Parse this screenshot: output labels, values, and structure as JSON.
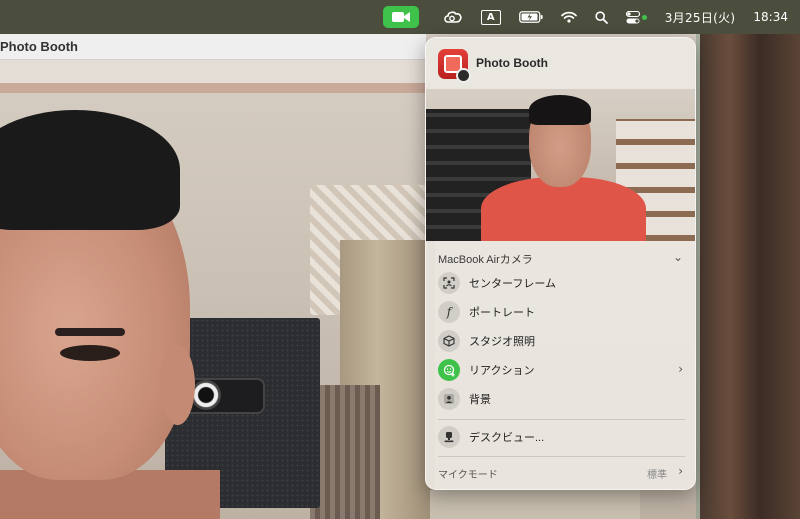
{
  "menubar": {
    "date": "3月25日(火)",
    "time": "18:34",
    "input_indicator": "A",
    "icons": [
      "facetime-camera-icon",
      "creative-cloud-icon",
      "input-source-icon",
      "battery-icon",
      "wifi-icon",
      "search-icon",
      "control-center-icon"
    ],
    "accent_color": "#3ec24a"
  },
  "photobooth": {
    "window_title": "Photo Booth"
  },
  "popover": {
    "app_name": "Photo Booth",
    "camera_section": "MacBook Airカメラ",
    "items": [
      {
        "label": "センターフレーム",
        "icon": "center-stage-icon"
      },
      {
        "label": "ポートレート",
        "icon": "portrait-icon"
      },
      {
        "label": "スタジオ照明",
        "icon": "studio-light-icon"
      },
      {
        "label": "リアクション",
        "icon": "reactions-icon"
      },
      {
        "label": "背景",
        "icon": "background-icon"
      }
    ],
    "desk_view": "デスクビュー...",
    "mic_mode_label": "マイクモード",
    "mic_mode_value": "標準"
  }
}
